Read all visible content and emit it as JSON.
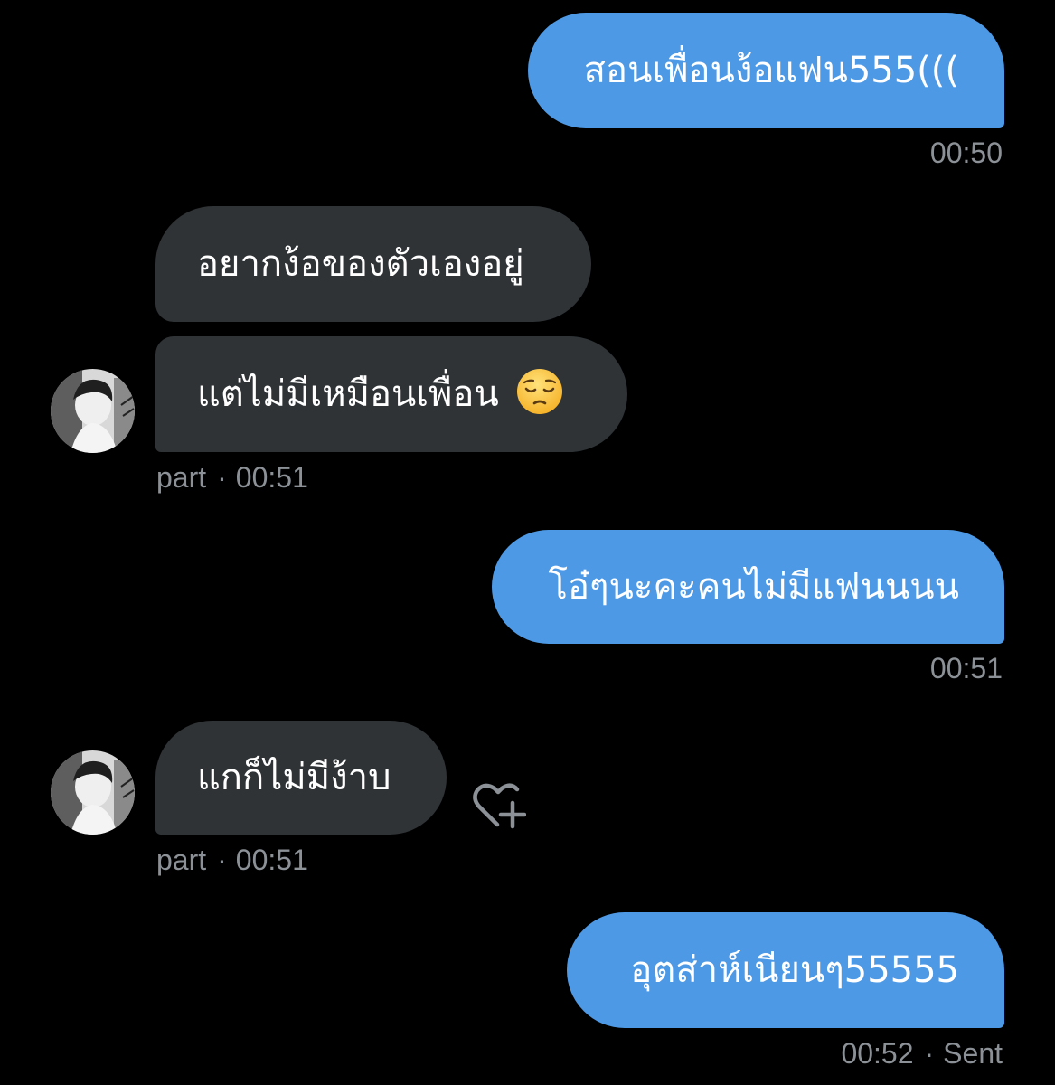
{
  "conversation": {
    "messages": [
      {
        "direction": "outgoing",
        "text": "สอนเพื่อนง้อแฟน555(((",
        "time": "00:50"
      },
      {
        "direction": "incoming",
        "text": "อยากง้อของตัวเองอยู่"
      },
      {
        "direction": "incoming",
        "text": "แต่ไม่มีเหมือนเพื่อน",
        "emoji": "pensive-face-emoji",
        "sender": "part",
        "time": "00:51"
      },
      {
        "direction": "outgoing",
        "text": "โอ๋ๆนะคะคนไม่มีแฟนนนน",
        "time": "00:51"
      },
      {
        "direction": "incoming",
        "text": "แกก็ไม่มีง้าบ",
        "sender": "part",
        "time": "00:51",
        "reaction_action": "add-reaction-heart-plus"
      },
      {
        "direction": "outgoing",
        "text": "อุตส่าห์เนียนๆ55555",
        "time": "00:52",
        "status": "Sent"
      }
    ]
  },
  "colors": {
    "background": "#000000",
    "outgoing_bubble": "#4d99e6",
    "incoming_bubble": "#2f3336",
    "meta_text": "#8b9196"
  }
}
